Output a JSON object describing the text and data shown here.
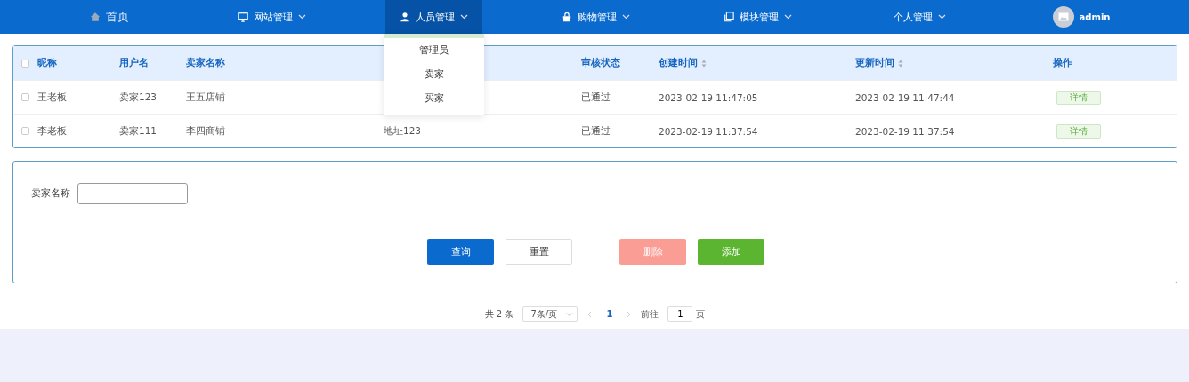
{
  "nav": {
    "items": [
      {
        "label": "首页",
        "has_caret": false,
        "selected": false
      },
      {
        "label": "网站管理",
        "has_caret": true,
        "selected": false
      },
      {
        "label": "人员管理",
        "has_caret": true,
        "selected": true
      },
      {
        "label": "购物管理",
        "has_caret": true,
        "selected": false
      },
      {
        "label": "模块管理",
        "has_caret": true,
        "selected": false
      },
      {
        "label": "个人管理",
        "has_caret": true,
        "selected": false
      }
    ],
    "user": {
      "name": "admin"
    },
    "dropdown": {
      "items": [
        "管理员",
        "卖家",
        "买家"
      ]
    }
  },
  "table": {
    "header_checked": false,
    "columns": [
      {
        "label": "昵称",
        "sortable": false
      },
      {
        "label": "用户名",
        "sortable": false
      },
      {
        "label": "卖家名称",
        "sortable": false
      },
      {
        "sortable": false
      },
      {
        "label": "审核状态",
        "sortable": false
      },
      {
        "label": "创建时间",
        "sortable": true
      },
      {
        "label": "更新时间",
        "sortable": true
      },
      {
        "label": "操作",
        "sortable": false
      }
    ],
    "rows": [
      {
        "checked": false,
        "cells": [
          "王老板",
          "卖家123",
          "王五店铺",
          null,
          "已通过",
          "2023-02-19 11:47:05",
          "2023-02-19 11:47:44"
        ],
        "action": "详情"
      },
      {
        "checked": false,
        "cells": [
          "李老板",
          "卖家111",
          "李四商铺",
          "地址123",
          "已通过",
          "2023-02-19 11:37:54",
          "2023-02-19 11:37:54"
        ],
        "action": "详情"
      }
    ]
  },
  "search": {
    "label": "卖家名称"
  },
  "buttons": [
    {
      "label": "查询",
      "kind": "primary",
      "disabled": false
    },
    {
      "label": "重置",
      "kind": "plain",
      "disabled": false
    },
    {
      "label": "删除",
      "kind": "danger",
      "disabled": true
    },
    {
      "label": "添加",
      "kind": "success",
      "disabled": false
    }
  ],
  "pagination": {
    "total": "共 2 条",
    "page_size": "7条/页",
    "pages": [
      {
        "label": "1",
        "selected": true
      }
    ],
    "goto_label": "前往",
    "goto_value": "1",
    "page_suffix": "页"
  }
}
